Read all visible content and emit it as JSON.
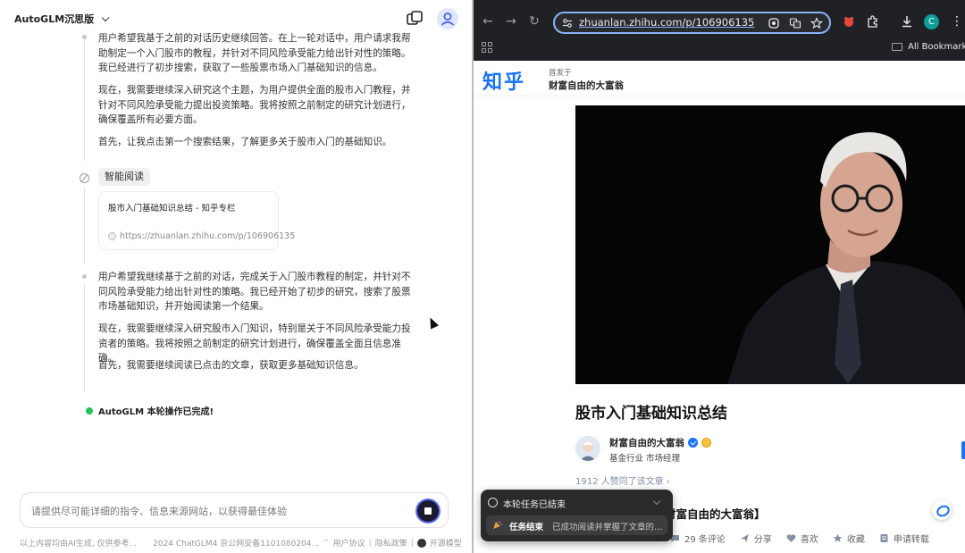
{
  "app": {
    "title": "AutoGLM沉思版"
  },
  "conversation": {
    "block1": {
      "p1": "用户希望我基于之前的对话历史继续回答。在上一轮对话中，用户请求我帮助制定一个入门股市的教程，并针对不同风险承受能力给出针对性的策略。我已经进行了初步搜索，获取了一些股票市场入门基础知识的信息。",
      "p2": "现在，我需要继续深入研究这个主题，为用户提供全面的股市入门教程，并针对不同风险承受能力提出投资策略。我将按照之前制定的研究计划进行，确保覆盖所有必要方面。",
      "p3": "首先，让我点击第一个搜索结果，了解更多关于股市入门的基础知识。"
    },
    "tool": {
      "label": "智能阅读",
      "card_title": "股市入门基础知识总结 - 知乎专栏",
      "card_url": "https://zhuanlan.zhihu.com/p/106906135"
    },
    "block2": {
      "p1": "用户希望我继续基于之前的对话，完成关于入门股市教程的制定，并针对不同风险承受能力给出针对性的策略。我已经开始了初步的研究，搜索了股票市场基础知识，并开始阅读第一个结果。",
      "p2": "现在，我需要继续深入研究股市入门知识，特别是关于不同风险承受能力投资者的策略。我将按照之前制定的研究计划进行，确保覆盖全面且信息准确。",
      "p3": "首先，我需要继续阅读已点击的文章，获取更多基础知识信息。"
    },
    "status": "AutoGLM 本轮操作已完成!"
  },
  "input": {
    "placeholder": "请提供尽可能详细的指令、信息来源网站，以获得最佳体验"
  },
  "footer": {
    "disclaimer": "以上内容均由AI生成, 仅供参考...",
    "license": "2024 ChatGLM4 京公网安备1101080204...",
    "user_agreement": "用户协议",
    "privacy": "隐私政策",
    "open_model": "开源模型"
  },
  "browser": {
    "url": "zhuanlan.zhihu.com/p/106906135",
    "all_bookmarks": "All Bookmarks",
    "profile_initial": "C",
    "accent": "#8ab4f8"
  },
  "zhihu": {
    "logo": "知乎",
    "published_in_label": "首发于",
    "column_name": "财富自由的大富翁",
    "article_title": "股市入门基础知识总结",
    "author_name": "财富自由的大富翁",
    "author_desc": "基金行业 市场经理",
    "likes": "1912 人赞同了该文章 ›",
    "partial_heading": "【文章原创作者：财富自由的大富翁】",
    "actions": {
      "comments": "29 条评论",
      "share": "分享",
      "like": "喜欢",
      "favorite": "收藏",
      "reprint": "申请转载"
    },
    "brand_color": "#1772f6"
  },
  "toast": {
    "title": "本轮任务已结束",
    "label": "任务结束",
    "message": "已成功阅读并掌握了文章的全..."
  }
}
